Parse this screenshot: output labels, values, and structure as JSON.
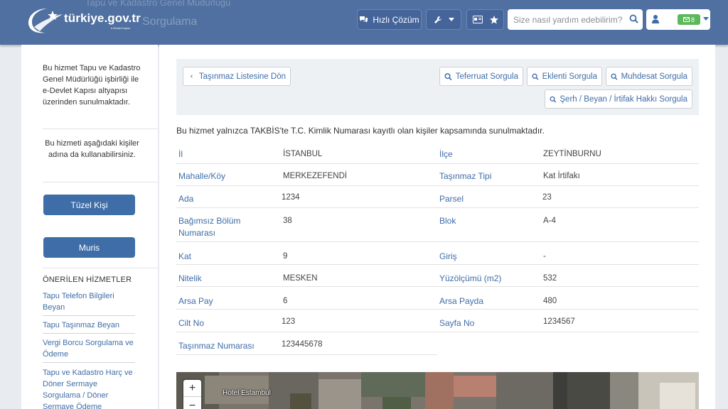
{
  "header": {
    "ghost_text": "Tapu ve Kadastro Genel Müdürlüğü",
    "ghost_title": "Sorgulama",
    "logo_text": "türkiye.gov.tr",
    "logo_sub": "e-Devlet Kapısı",
    "hizli_cozum": "Hızlı Çözüm",
    "search_placeholder": "Size nasıl yardım edebilirim?",
    "mail_count": "8",
    "accent": "#4f70a0"
  },
  "sidebar": {
    "intro": "Bu hizmet Tapu ve Kadastro Genel Müdürlüğü işbirliği ile e-Devlet Kapısı altyapısı üzerinden sunulmaktadır.",
    "on_behalf": "Bu hizmeti aşağıdaki kişiler adına da kullanabilirsiniz.",
    "btn_tuzel": "Tüzel Kişi",
    "btn_muris": "Muris",
    "suggested_heading": "ÖNERİLEN HİZMETLER",
    "links": [
      "Tapu Telefon Bilgileri Beyan",
      "Tapu Taşınmaz Beyan",
      "Vergi Borcu Sorgulama ve Ödeme",
      "Tapu ve Kadastro Harç ve Döner Sermaye Sorgulama / Döner Sermaye Ödeme"
    ],
    "button_color": "#3f6da8"
  },
  "toolbar": {
    "back": "Taşınmaz Listesine Dön",
    "teferruat": "Teferruat Sorgula",
    "eklenti": "Eklenti Sorgula",
    "muhdesat": "Muhdesat Sorgula",
    "serh": "Şerh / Beyan / İrtifak Hakkı Sorgula"
  },
  "info_text": "Bu hizmet yalnızca TAKBİS'te T.C. Kimlik Numarası kayıtlı olan kişiler kapsamında sunulmaktadır.",
  "details": {
    "il_label": "İl",
    "il_value": "İSTANBUL",
    "ilce_label": "İlçe",
    "ilce_value": "ZEYTİNBURNU",
    "mahalle_label": "Mahalle/Köy",
    "mahalle_value": "MERKEZEFENDİ",
    "tip_label": "Taşınmaz Tipi",
    "tip_value": "Kat İrtifakı",
    "ada_label": "Ada",
    "ada_value": "1234",
    "parsel_label": "Parsel",
    "parsel_value": "23",
    "bolum_label": "Bağımsız Bölüm Numarası",
    "bolum_value": "38",
    "blok_label": "Blok",
    "blok_value": "A-4",
    "kat_label": "Kat",
    "kat_value": "9",
    "giris_label": "Giriş",
    "giris_value": "-",
    "nitelik_label": "Nitelik",
    "nitelik_value": "MESKEN",
    "yuzolcumu_label": "Yüzölçümü (m2)",
    "yuzolcumu_value": "532",
    "arsapay_label": "Arsa Pay",
    "arsapay_value": "6",
    "arsapayda_label": "Arsa Payda",
    "arsapayda_value": "480",
    "cilt_label": "Cilt No",
    "cilt_value": "123",
    "sayfa_label": "Sayfa No",
    "sayfa_value": "1234567",
    "tasinmaz_label": "Taşınmaz Numarası",
    "tasinmaz_value": "123445678"
  },
  "map": {
    "zoom_in": "+",
    "zoom_out": "−",
    "place_label": "Hotel Estambul"
  }
}
